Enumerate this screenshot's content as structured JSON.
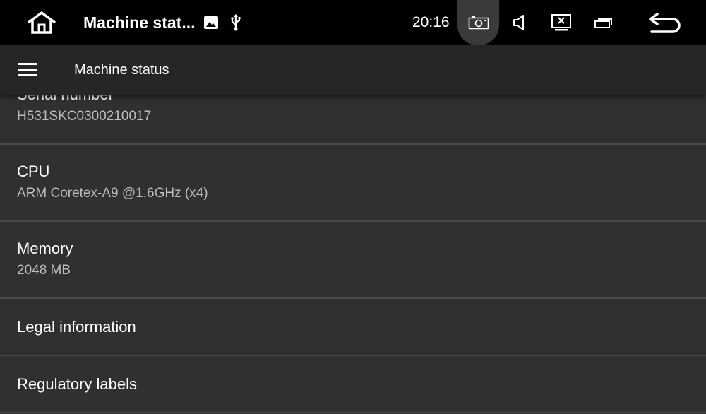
{
  "status_bar": {
    "title": "Machine stat...",
    "time": "20:16",
    "icons": [
      "home-icon",
      "image-icon",
      "usb-icon",
      "screenshot-icon",
      "volume-icon",
      "close-screen-icon",
      "recent-apps-icon",
      "back-icon"
    ]
  },
  "app_bar": {
    "title": "Machine status",
    "menu_icon": "hamburger-menu-icon"
  },
  "list": {
    "items": [
      {
        "title": "Serial number",
        "summary": "H531SKC0300210017"
      },
      {
        "title": "CPU",
        "summary": "ARM Coretex-A9 @1.6GHz (x4)"
      },
      {
        "title": "Memory",
        "summary": "2048 MB"
      },
      {
        "title": "Legal information"
      },
      {
        "title": "Regulatory labels"
      }
    ]
  },
  "colors": {
    "status_bar_bg": "#000000",
    "app_bar_bg": "#262626",
    "content_bg": "#303030",
    "divider": "#4a4a4a",
    "secondary_text": "#bdbdbd"
  }
}
